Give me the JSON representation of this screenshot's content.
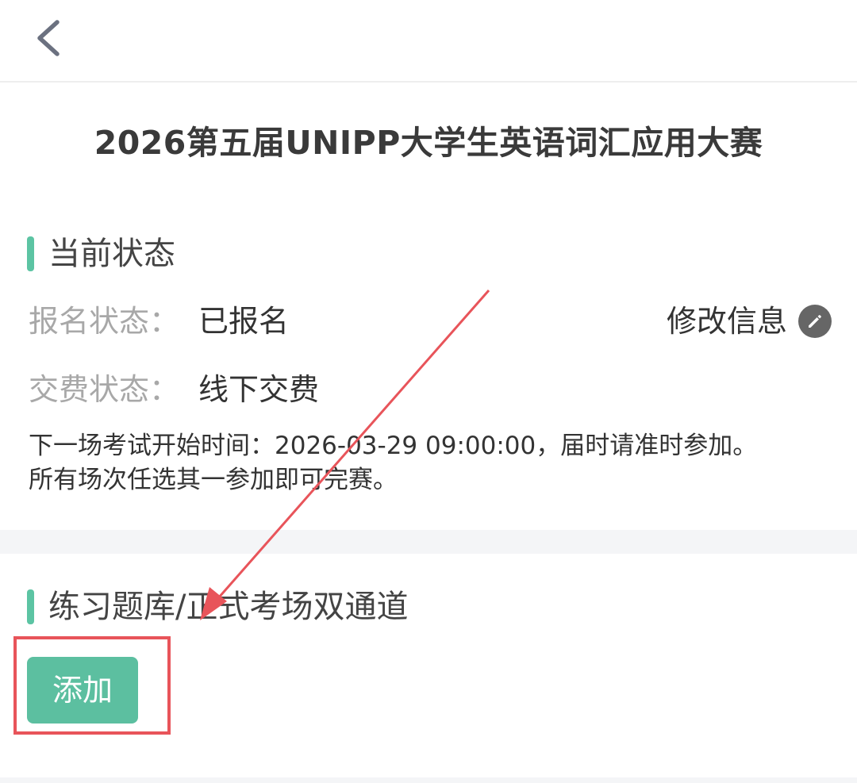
{
  "header": {
    "back_icon": "chevron-left-icon"
  },
  "page": {
    "title": "2026第五届UNIPP大学生英语词汇应用大赛"
  },
  "status_section": {
    "title": "当前状态",
    "registration": {
      "label": "报名状态：",
      "value": "已报名"
    },
    "payment": {
      "label": "交费状态：",
      "value": "线下交费"
    },
    "edit": {
      "label": "修改信息",
      "icon": "pencil-icon"
    },
    "notice_line1": "下一场考试开始时间：2026-03-29 09:00:00，届时请准时参加。",
    "notice_line2": "所有场次任选其一参加即可完赛。"
  },
  "channel_section": {
    "title": "练习题库/正式考场双通道",
    "add_button_label": "添加"
  },
  "colors": {
    "accent": "#5cc4a3",
    "button": "#5cbfa0",
    "annotation": "#e8545a"
  }
}
